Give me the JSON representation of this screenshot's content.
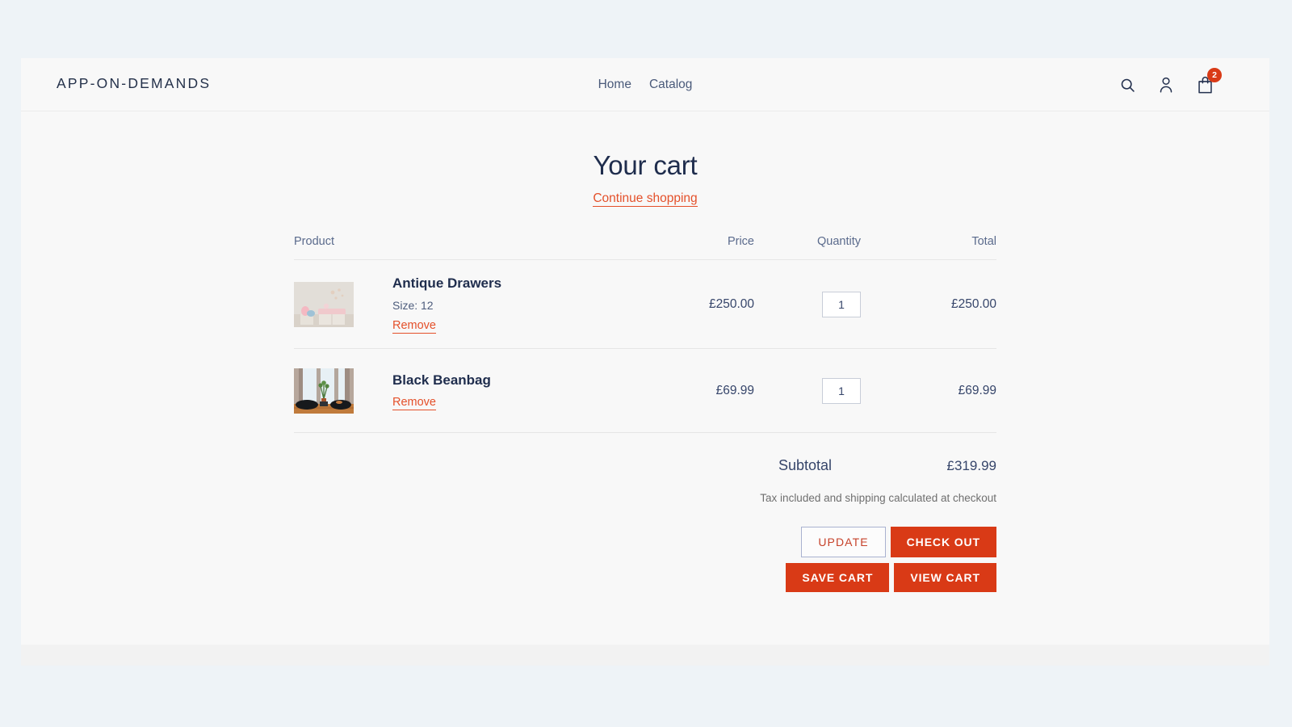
{
  "header": {
    "logo": "APP-ON-DEMANDS",
    "nav": [
      {
        "label": "Home"
      },
      {
        "label": "Catalog"
      }
    ],
    "icons": {
      "search": "search-icon",
      "account": "account-icon",
      "cart": "cart-icon"
    },
    "cart_count": "2"
  },
  "cart": {
    "title": "Your cart",
    "continue_shopping": "Continue shopping",
    "columns": {
      "product": "Product",
      "price": "Price",
      "quantity": "Quantity",
      "total": "Total"
    },
    "items": [
      {
        "title": "Antique Drawers",
        "variant": "Size: 12",
        "remove": "Remove",
        "price": "£250.00",
        "quantity": "1",
        "total": "£250.00"
      },
      {
        "title": "Black Beanbag",
        "variant": "",
        "remove": "Remove",
        "price": "£69.99",
        "quantity": "1",
        "total": "£69.99"
      }
    ],
    "subtotal_label": "Subtotal",
    "subtotal_value": "£319.99",
    "tax_note": "Tax included and shipping calculated at checkout",
    "buttons": {
      "update": "UPDATE",
      "check_out": "CHECK OUT",
      "save_cart": "SAVE CART",
      "view_cart": "VIEW CART"
    }
  },
  "colors": {
    "accent_red": "#d93a16",
    "link_red": "#e4502a",
    "navy": "#1f2d4d",
    "page_bg": "#eef3f7",
    "panel_bg": "#f8f8f8"
  }
}
